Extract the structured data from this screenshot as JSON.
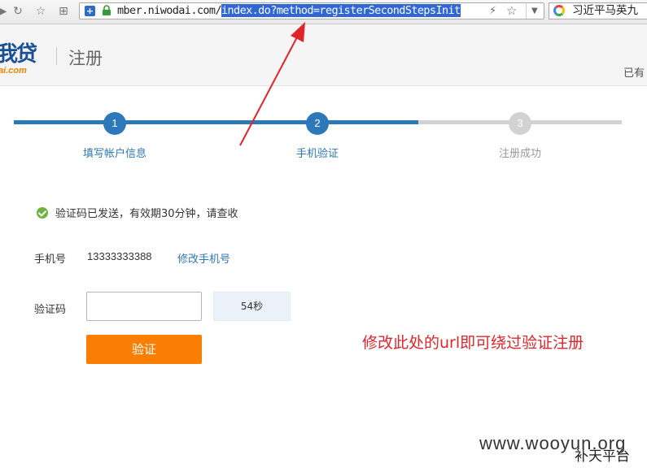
{
  "browser": {
    "url_prefix": "mber.niwodai.com/",
    "url_selected": "index.do?method=registerSecondStepsInit",
    "search_text": "习近平马英九"
  },
  "header": {
    "logo_cn": "我贷",
    "logo_en": "ai.com",
    "title": "注册",
    "right_text": "已有"
  },
  "steps": [
    {
      "number": "1",
      "label": "填写帐户信息",
      "state": "done"
    },
    {
      "number": "2",
      "label": "手机验证",
      "state": "current"
    },
    {
      "number": "3",
      "label": "注册成功",
      "state": "todo"
    }
  ],
  "form": {
    "notice": "验证码已发送，有效期30分钟，请查收",
    "phone_label": "手机号",
    "phone_value": "13333333388",
    "change_phone_link": "修改手机号",
    "code_label": "验证码",
    "code_value": "",
    "countdown": "54秒",
    "verify_button": "验证"
  },
  "annotation": {
    "text": "修改此处的url即可绕过验证注册",
    "color": "#e0252a"
  },
  "watermark": {
    "site": "www.wooyun.org",
    "platform": "补天平台"
  },
  "colors": {
    "brand_blue": "#2d78b8",
    "accent_orange": "#fb7e04",
    "success_green": "#6db33f",
    "inactive_gray": "#d2d2d2"
  }
}
